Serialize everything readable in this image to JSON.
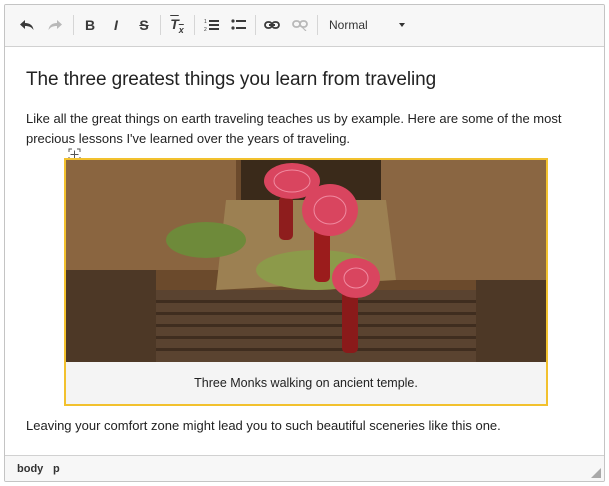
{
  "toolbar": {
    "undo_icon": "undo-icon",
    "redo_icon": "redo-icon",
    "bold_label": "B",
    "italic_label": "I",
    "strike_label": "S",
    "remove_format_label": "T",
    "remove_format_sub": "x",
    "numbered_list_icon": "numbered-list-icon",
    "bulleted_list_icon": "bulleted-list-icon",
    "link_icon": "link-icon",
    "unlink_icon": "unlink-icon",
    "format_value": "Normal"
  },
  "document": {
    "title": "The three greatest things you learn from traveling",
    "paragraph1": "Like all the great things on earth traveling teaches us by example. Here are some of the most precious lessons I've learned over the years of traveling.",
    "image_caption": "Three Monks walking on ancient temple.",
    "paragraph2": "Leaving your comfort zone might lead you to such beautiful sceneries like this one."
  },
  "statusbar": {
    "path": [
      "body",
      "p"
    ]
  },
  "colors": {
    "selection_border": "#f2c12e",
    "umbrella": "#d9455f",
    "robe": "#9b1c1c"
  }
}
